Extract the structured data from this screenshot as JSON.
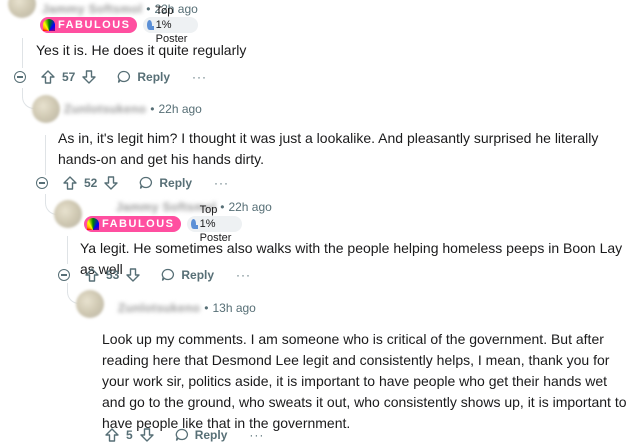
{
  "comments": [
    {
      "username": "Jammy Softsmol",
      "time": "22h ago",
      "flair_fab": "FABULOUS",
      "flair_top": "Top 1% Poster",
      "body": "Yes it is. He does it quite regularly",
      "score": "57",
      "reply": "Reply",
      "more": "···"
    },
    {
      "username": "Zunlotsukeno",
      "time": "22h ago",
      "body": "As in, it's legit him? I thought it was just a lookalike. And pleasantly surprised he literally hands-on and get his hands dirty.",
      "score": "52",
      "reply": "Reply",
      "more": "···"
    },
    {
      "username": "Jammy Softsmol",
      "time": "22h ago",
      "flair_fab": "FABULOUS",
      "flair_top": "Top 1% Poster",
      "body": "Ya legit. He sometimes also walks with the people helping homeless peeps in Boon Lay as well",
      "score": "53",
      "reply": "Reply",
      "more": "···"
    },
    {
      "username": "Zunlotsukeno",
      "time": "13h ago",
      "body": "Look up my comments. I am someone who is critical of the government. But after reading here that Desmond Lee legit and consistently helps, I mean, thank you for your work sir, politics aside, it is important to have people who get their hands wet and go to the ground, who sweats it out, who consistently shows up, it is important to have people like that in the government.",
      "score": "5",
      "reply": "Reply",
      "more": "···"
    }
  ],
  "colors": {
    "meta": "#576f76",
    "fabulous": "#ff4fa0",
    "thread_line": "#dfe3e6"
  },
  "icons": [
    "avatar",
    "rainbow-icon",
    "top-poster-icon",
    "collapse-icon",
    "upvote-icon",
    "downvote-icon",
    "reply-icon",
    "more-icon"
  ]
}
